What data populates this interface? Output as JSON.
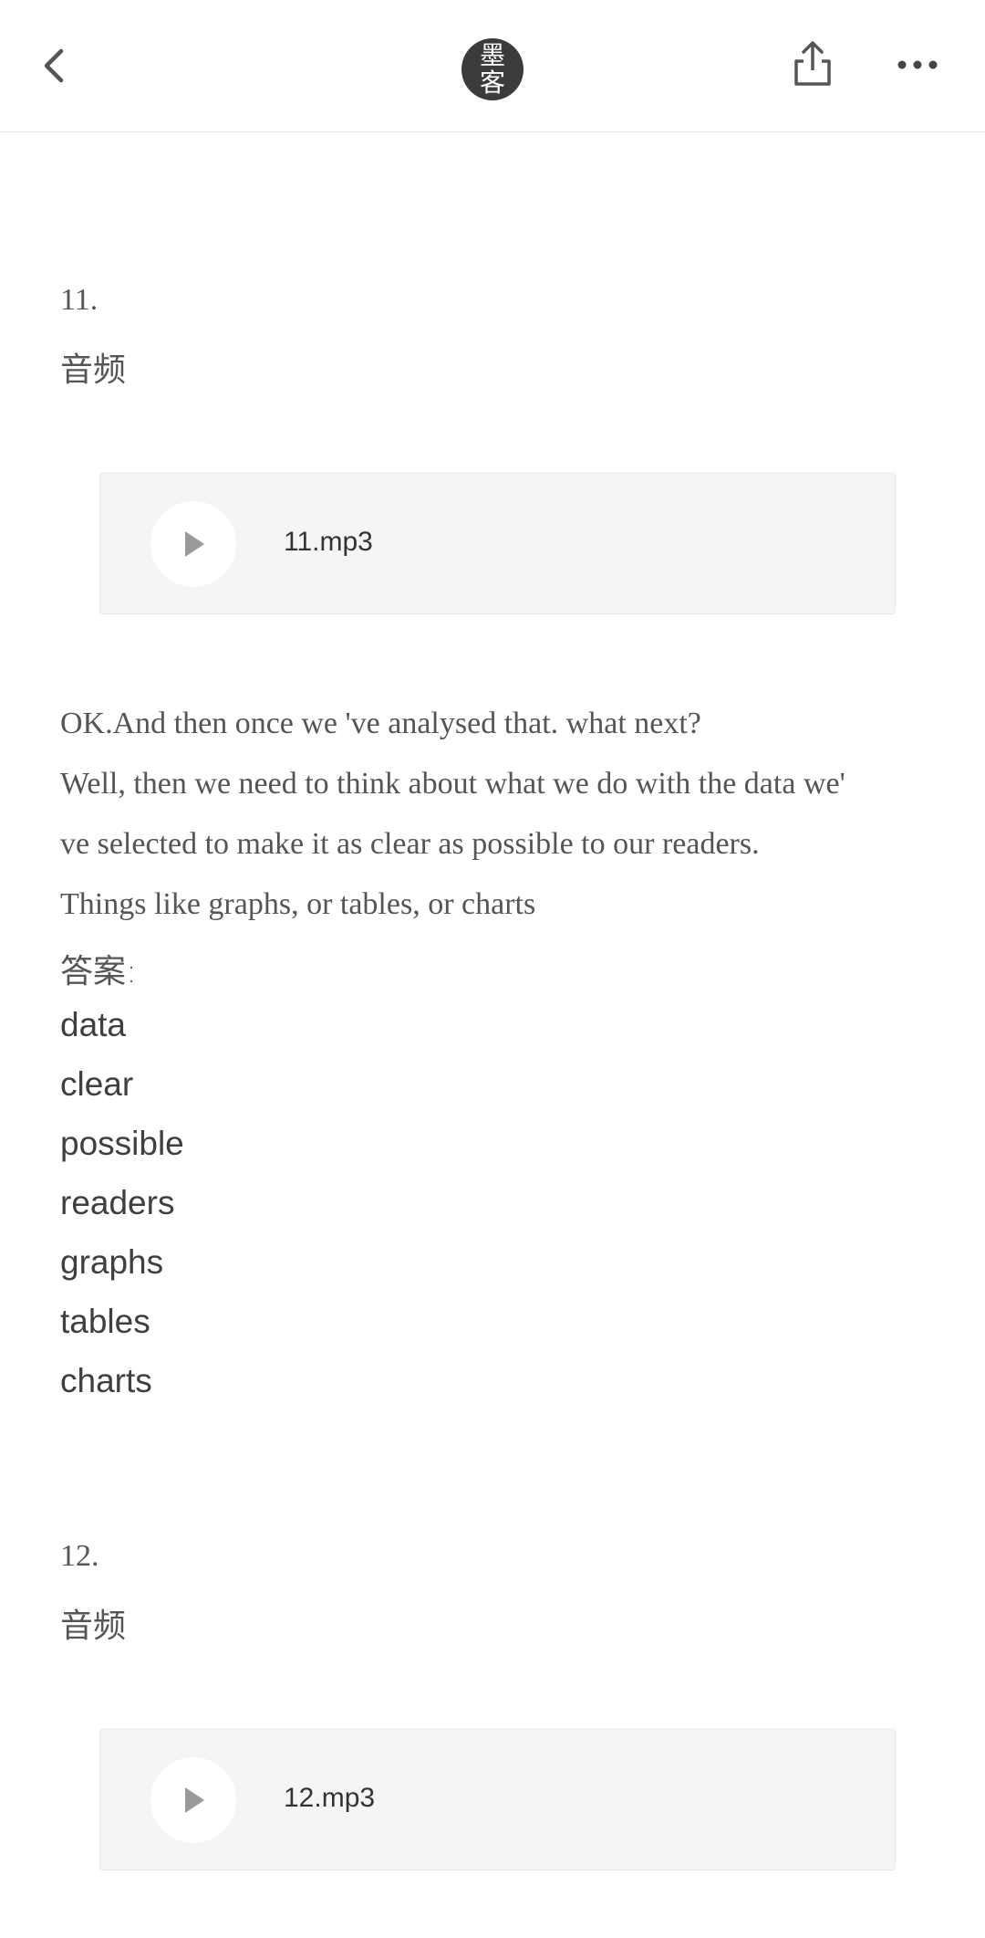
{
  "header": {
    "logo_text_line1": "墨",
    "logo_text_line2": "客",
    "icons": [
      "chevron-left-icon",
      "share-icon",
      "more-icon"
    ]
  },
  "sections": [
    {
      "number": "11.",
      "label": "音频",
      "audio": {
        "filename": "11.mp3"
      },
      "transcript": [
        "OK.And then once we 've analysed that. what next?",
        "Well, then we need to think about what we do with the data we'",
        "ve selected to make it as clear as possible to our readers.",
        "Things like graphs, or tables, or charts"
      ],
      "answer_label": "答案:",
      "answers": [
        "data",
        "clear",
        "possible",
        "readers",
        "graphs",
        "tables",
        "charts"
      ]
    },
    {
      "number": "12.",
      "label": "音频",
      "audio": {
        "filename": "12.mp3"
      }
    }
  ],
  "colors": {
    "text": "#555555",
    "logo_bg": "#3a3b3d",
    "card_bg": "#f5f5f5",
    "play_icon": "#999999"
  }
}
